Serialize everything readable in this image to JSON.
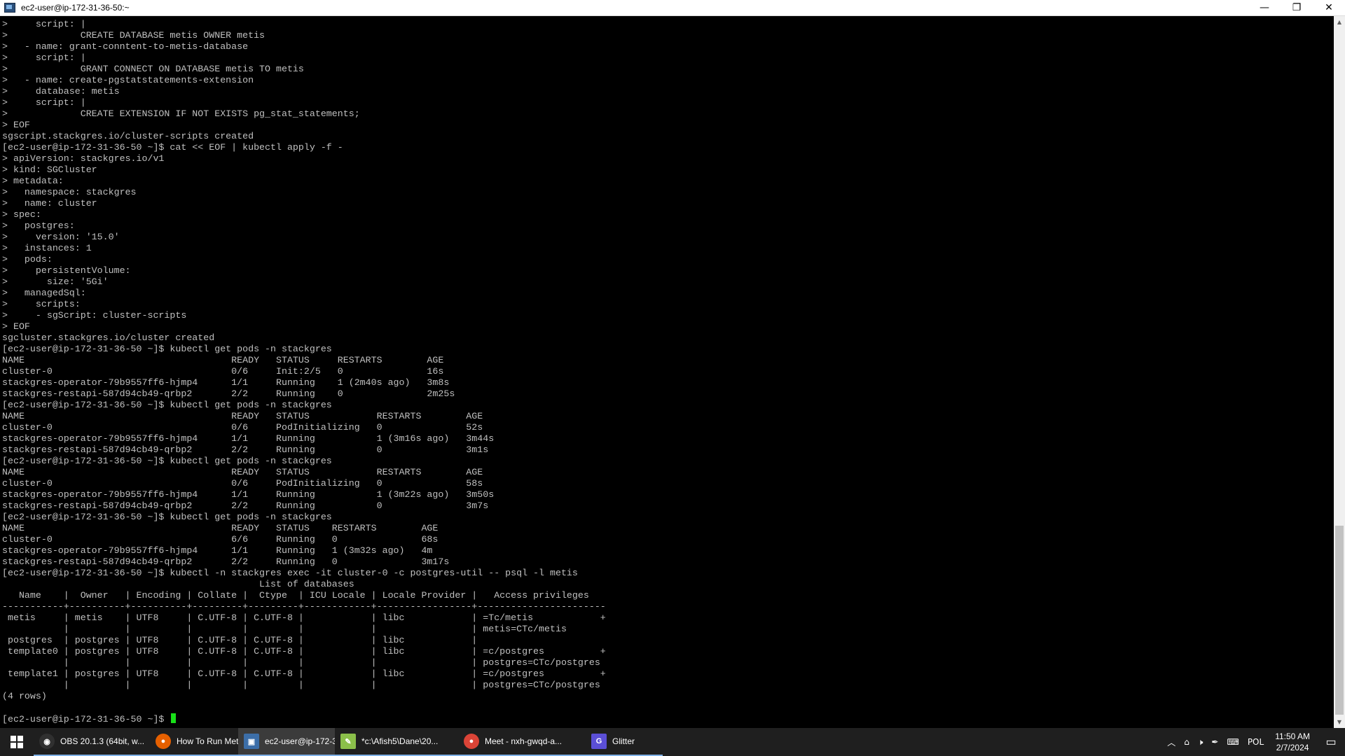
{
  "window": {
    "title": "ec2-user@ip-172-31-36-50:~",
    "minimize_glyph": "—",
    "restore_glyph": "❐",
    "close_glyph": "✕"
  },
  "terminal": {
    "lines": [
      ">     script: |",
      ">             CREATE DATABASE metis OWNER metis",
      ">   - name: grant-conntent-to-metis-database",
      ">     script: |",
      ">             GRANT CONNECT ON DATABASE metis TO metis",
      ">   - name: create-pgstatstatements-extension",
      ">     database: metis",
      ">     script: |",
      ">             CREATE EXTENSION IF NOT EXISTS pg_stat_statements;",
      "> EOF",
      "sgscript.stackgres.io/cluster-scripts created",
      "[ec2-user@ip-172-31-36-50 ~]$ cat << EOF | kubectl apply -f -",
      "> apiVersion: stackgres.io/v1",
      "> kind: SGCluster",
      "> metadata:",
      ">   namespace: stackgres",
      ">   name: cluster",
      "> spec:",
      ">   postgres:",
      ">     version: '15.0'",
      ">   instances: 1",
      ">   pods:",
      ">     persistentVolume:",
      ">       size: '5Gi'",
      ">   managedSql:",
      ">     scripts:",
      ">     - sgScript: cluster-scripts",
      "> EOF",
      "sgcluster.stackgres.io/cluster created",
      "[ec2-user@ip-172-31-36-50 ~]$ kubectl get pods -n stackgres",
      "NAME                                     READY   STATUS     RESTARTS        AGE",
      "cluster-0                                0/6     Init:2/5   0               16s",
      "stackgres-operator-79b9557ff6-hjmp4      1/1     Running    1 (2m40s ago)   3m8s",
      "stackgres-restapi-587d94cb49-qrbp2       2/2     Running    0               2m25s",
      "[ec2-user@ip-172-31-36-50 ~]$ kubectl get pods -n stackgres",
      "NAME                                     READY   STATUS            RESTARTS        AGE",
      "cluster-0                                0/6     PodInitializing   0               52s",
      "stackgres-operator-79b9557ff6-hjmp4      1/1     Running           1 (3m16s ago)   3m44s",
      "stackgres-restapi-587d94cb49-qrbp2       2/2     Running           0               3m1s",
      "[ec2-user@ip-172-31-36-50 ~]$ kubectl get pods -n stackgres",
      "NAME                                     READY   STATUS            RESTARTS        AGE",
      "cluster-0                                0/6     PodInitializing   0               58s",
      "stackgres-operator-79b9557ff6-hjmp4      1/1     Running           1 (3m22s ago)   3m50s",
      "stackgres-restapi-587d94cb49-qrbp2       2/2     Running           0               3m7s",
      "[ec2-user@ip-172-31-36-50 ~]$ kubectl get pods -n stackgres",
      "NAME                                     READY   STATUS    RESTARTS        AGE",
      "cluster-0                                6/6     Running   0               68s",
      "stackgres-operator-79b9557ff6-hjmp4      1/1     Running   1 (3m32s ago)   4m",
      "stackgres-restapi-587d94cb49-qrbp2       2/2     Running   0               3m17s",
      "[ec2-user@ip-172-31-36-50 ~]$ kubectl -n stackgres exec -it cluster-0 -c postgres-util -- psql -l metis",
      "                                              List of databases",
      "   Name    |  Owner   | Encoding | Collate |  Ctype  | ICU Locale | Locale Provider |   Access privileges",
      "-----------+----------+----------+---------+---------+------------+-----------------+-----------------------",
      " metis     | metis    | UTF8     | C.UTF-8 | C.UTF-8 |            | libc            | =Tc/metis            +",
      "           |          |          |         |         |            |                 | metis=CTc/metis",
      " postgres  | postgres | UTF8     | C.UTF-8 | C.UTF-8 |            | libc            |",
      " template0 | postgres | UTF8     | C.UTF-8 | C.UTF-8 |            | libc            | =c/postgres          +",
      "           |          |          |         |         |            |                 | postgres=CTc/postgres",
      " template1 | postgres | UTF8     | C.UTF-8 | C.UTF-8 |            | libc            | =c/postgres          +",
      "           |          |          |         |         |            |                 | postgres=CTc/postgres",
      "(4 rows)",
      ""
    ],
    "prompt": "[ec2-user@ip-172-31-36-50 ~]$ ",
    "cursor_color": "#18e018"
  },
  "taskbar": {
    "items": [
      {
        "label": "OBS 20.1.3 (64bit, w...",
        "icon": "obs-icon",
        "icon_glyph": "◉",
        "icon_color": "#303030"
      },
      {
        "label": "How To Run Metis ...",
        "icon": "firefox-icon",
        "icon_glyph": "●",
        "icon_color": "#e66000"
      },
      {
        "label": "ec2-user@ip-172-3...",
        "icon": "putty-icon",
        "icon_glyph": "▣",
        "icon_color": "#3c6ea8"
      },
      {
        "label": "*c:\\Afish5\\Dane\\20...",
        "icon": "notepad-icon",
        "icon_glyph": "✎",
        "icon_color": "#8bbf4a"
      },
      {
        "label": "Meet - nxh-gwqd-a...",
        "icon": "chrome-icon",
        "icon_glyph": "●",
        "icon_color": "#db4437"
      },
      {
        "label": "Glitter",
        "icon": "glitter-icon",
        "icon_glyph": "G",
        "icon_color": "#5b4fd6"
      }
    ],
    "tray": {
      "chevron": "︿",
      "language": "POL",
      "time": "11:50 AM",
      "date": "2/7/2024"
    }
  }
}
